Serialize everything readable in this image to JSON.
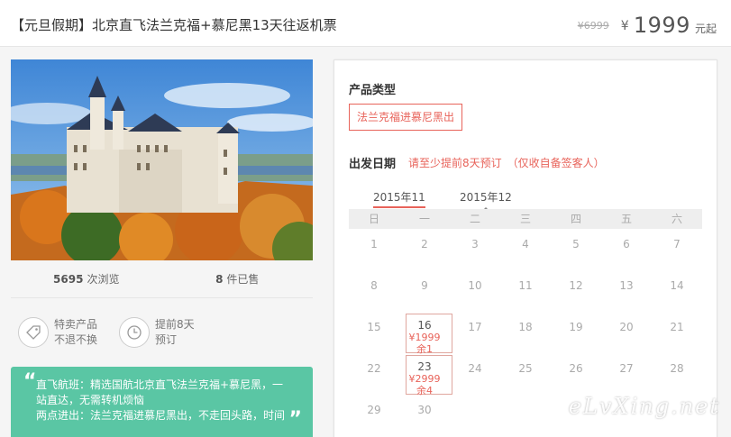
{
  "header": {
    "title": "【元旦假期】北京直飞法兰克福+慕尼黑13天往返机票",
    "old_price": "¥6999",
    "currency": "¥",
    "price": "1999",
    "price_suffix": "元起"
  },
  "stats": {
    "views_count": "5695",
    "views_label": "次浏览",
    "sold_count": "8",
    "sold_label": "件已售"
  },
  "features": [
    {
      "icon": "tag-icon",
      "line1": "特卖产品",
      "line2": "不退不换"
    },
    {
      "icon": "clock-icon",
      "line1": "提前8天",
      "line2": "预订"
    }
  ],
  "highlight": {
    "line1": "直飞航班：精选国航北京直飞法兰克福+慕尼黑，一",
    "line2": "站直达，无需转机烦恼",
    "line3": "两点进出：法兰克福进慕尼黑出，不走回头路，时间"
  },
  "booking": {
    "type_label": "产品类型",
    "type_option": "法兰克福进慕尼黑出",
    "date_label": "出发日期",
    "date_hint": "请至少提前8天预订　（仅收自备签客人）",
    "months": [
      "2015年11",
      "2015年12"
    ],
    "weekdays": [
      "日",
      "一",
      "二",
      "三",
      "四",
      "五",
      "六"
    ],
    "rows": [
      [
        {
          "d": "1"
        },
        {
          "d": "2"
        },
        {
          "d": "3"
        },
        {
          "d": "4"
        },
        {
          "d": "5"
        },
        {
          "d": "6"
        },
        {
          "d": "7"
        }
      ],
      [
        {
          "d": "8"
        },
        {
          "d": "9"
        },
        {
          "d": "10"
        },
        {
          "d": "11"
        },
        {
          "d": "12"
        },
        {
          "d": "13"
        },
        {
          "d": "14"
        }
      ],
      [
        {
          "d": "15"
        },
        {
          "d": "16",
          "price": "¥1999",
          "left": "余1"
        },
        {
          "d": "17"
        },
        {
          "d": "18"
        },
        {
          "d": "19"
        },
        {
          "d": "20"
        },
        {
          "d": "21"
        }
      ],
      [
        {
          "d": "22"
        },
        {
          "d": "23",
          "price": "¥2999",
          "left": "余4"
        },
        {
          "d": "24"
        },
        {
          "d": "25"
        },
        {
          "d": "26"
        },
        {
          "d": "27"
        },
        {
          "d": "28"
        }
      ],
      [
        {
          "d": "29"
        },
        {
          "d": "30"
        },
        {
          "d": ""
        },
        {
          "d": ""
        },
        {
          "d": ""
        },
        {
          "d": ""
        },
        {
          "d": ""
        }
      ]
    ]
  },
  "watermark": "eLvXing.net",
  "colors": {
    "accent": "#e8635a",
    "green": "#5ac6a4"
  }
}
